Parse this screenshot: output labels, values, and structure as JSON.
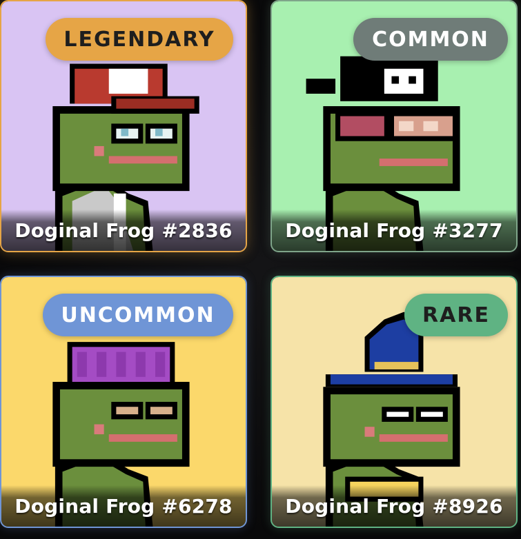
{
  "cards": [
    {
      "rarity": "LEGENDARY",
      "name": "Doginal Frog #2836",
      "colors": {
        "bg": "#d9c4f3",
        "badge_bg": "#e6a546",
        "badge_text": "#1e1e1e"
      },
      "hat_icon": "cap-icon"
    },
    {
      "rarity": "COMMON",
      "name": "Doginal Frog #3277",
      "colors": {
        "bg": "#a8f0b0",
        "badge_bg": "#6f7c78",
        "badge_text": "#ffffff"
      },
      "hat_icon": "pirate-bandana-icon"
    },
    {
      "rarity": "UNCOMMON",
      "name": "Doginal Frog #6278",
      "colors": {
        "bg": "#fbd86b",
        "badge_bg": "#6f95d6",
        "badge_text": "#ffffff"
      },
      "hat_icon": "beanie-icon"
    },
    {
      "rarity": "RARE",
      "name": "Doginal Frog #8926",
      "colors": {
        "bg": "#f6e3a8",
        "badge_bg": "#5fb383",
        "badge_text": "#1e1e1e"
      },
      "hat_icon": "wizard-hat-icon"
    }
  ]
}
